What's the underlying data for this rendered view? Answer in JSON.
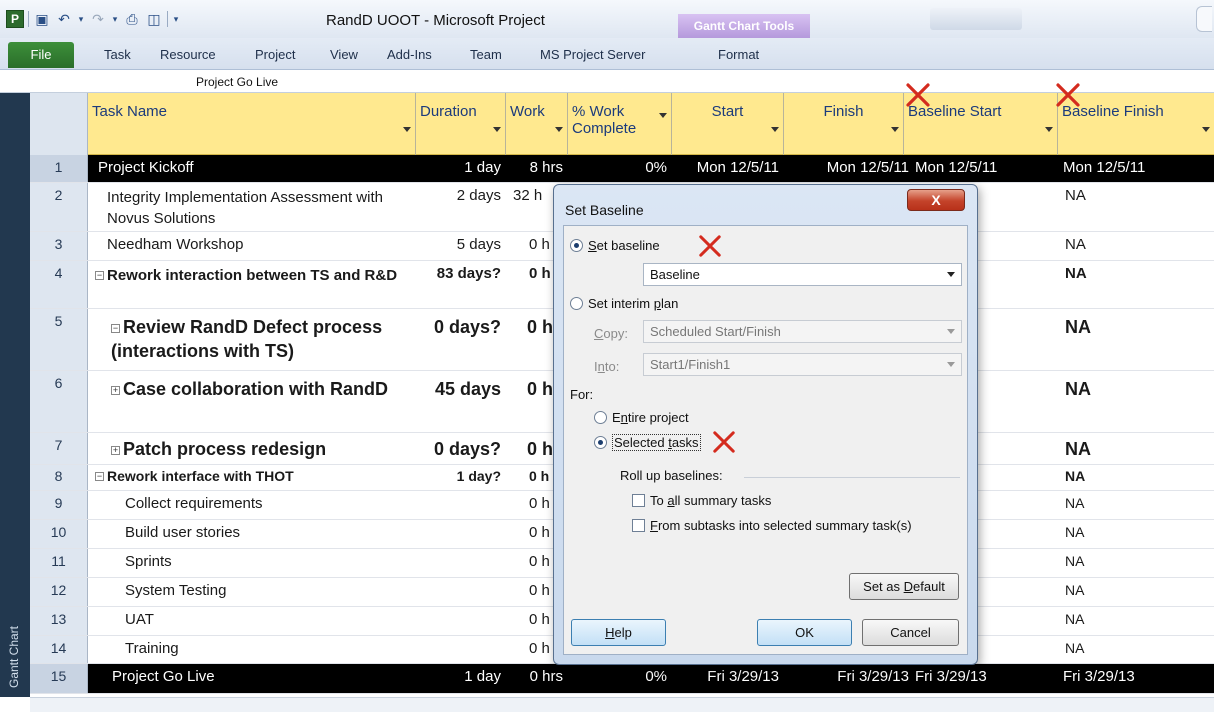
{
  "window": {
    "app_logo": "P",
    "title": "RandD UOOT - Microsoft Project",
    "tools_group": "Gantt Chart Tools"
  },
  "ribbon": {
    "file_tab": "File",
    "tabs": [
      "Task",
      "Resource",
      "Project",
      "View",
      "Add-Ins",
      "Team",
      "MS Project Server",
      "Format"
    ]
  },
  "entry_bar": {
    "value": "Project Go Live"
  },
  "sidebar": {
    "label": "Gantt Chart"
  },
  "columns": {
    "task_name": "Task Name",
    "duration": "Duration",
    "work": "Work",
    "pct_work_line1": "% Work",
    "pct_work_line2": "Complete",
    "start": "Start",
    "finish": "Finish",
    "baseline_start": "Baseline Start",
    "baseline_finish": "Baseline Finish"
  },
  "rows": [
    {
      "id": "1",
      "name": "Project Kickoff",
      "duration": "1 day",
      "work": "8 hrs",
      "pct": "0%",
      "start": "Mon 12/5/11",
      "finish": "Mon 12/5/11",
      "bstart": "Mon 12/5/11",
      "bfinish": "Mon 12/5/11"
    },
    {
      "id": "2",
      "name": "Integrity Implementation Assessment with Novus Solutions",
      "duration": "2 days",
      "work": "32 h",
      "bfinish": "NA"
    },
    {
      "id": "3",
      "name": "Needham Workshop",
      "duration": "5 days",
      "work": "0 h",
      "bfinish": "NA"
    },
    {
      "id": "4",
      "name": "Rework interaction between TS and R&D",
      "duration": "83 days?",
      "work": "0 h",
      "bfinish": "NA"
    },
    {
      "id": "5",
      "name": "Review RandD Defect process (interactions with TS)",
      "duration": "0 days?",
      "work": "0 h",
      "bfinish": "NA"
    },
    {
      "id": "6",
      "name": "Case collaboration with RandD",
      "duration": "45 days",
      "work": "0 h",
      "bfinish": "NA"
    },
    {
      "id": "7",
      "name": "Patch process redesign",
      "duration": "0 days?",
      "work": "0 h",
      "bfinish": "NA"
    },
    {
      "id": "8",
      "name": "Rework interface with THOT",
      "duration": "1 day?",
      "work": "0 h",
      "bfinish": "NA"
    },
    {
      "id": "9",
      "name": "Collect requirements",
      "work": "0 h",
      "bfinish": "NA"
    },
    {
      "id": "10",
      "name": "Build user stories",
      "work": "0 h",
      "bfinish": "NA"
    },
    {
      "id": "11",
      "name": "Sprints",
      "work": "0 h",
      "bfinish": "NA"
    },
    {
      "id": "12",
      "name": "System Testing",
      "work": "0 h",
      "bfinish": "NA"
    },
    {
      "id": "13",
      "name": "UAT",
      "work": "0 h",
      "bfinish": "NA"
    },
    {
      "id": "14",
      "name": "Training",
      "work": "0 h",
      "bfinish": "NA"
    },
    {
      "id": "15",
      "name": "Project Go Live",
      "duration": "1 day",
      "work": "0 hrs",
      "pct": "0%",
      "start": "Fri 3/29/13",
      "finish": "Fri 3/29/13",
      "bstart": "Fri 3/29/13",
      "bfinish": "Fri 3/29/13"
    }
  ],
  "expanders": {
    "minus": "−",
    "plus": "+"
  },
  "dialog": {
    "title": "Set Baseline",
    "close": "X",
    "set_baseline_pre": "",
    "set_baseline_u": "S",
    "set_baseline_post": "et baseline",
    "baseline_select": "Baseline",
    "interim_pre": "Set interim ",
    "interim_u": "p",
    "interim_post": "lan",
    "copy_u": "C",
    "copy_post": "opy:",
    "copy_value": "Scheduled Start/Finish",
    "into_pre": "I",
    "into_u": "n",
    "into_post": "to:",
    "into_value": "Start1/Finish1",
    "for_label": "For:",
    "entire_pre": "E",
    "entire_u": "n",
    "entire_post": "tire project",
    "selected_pre": "Selected ",
    "selected_u": "t",
    "selected_post": "asks",
    "rollup_label": "Roll up baselines:",
    "rollup_all_pre": "To ",
    "rollup_all_u": "a",
    "rollup_all_post": "ll summary tasks",
    "rollup_from_u": "F",
    "rollup_from_post": "rom subtasks into selected summary task(s)",
    "set_default_pre": "Set as ",
    "set_default_u": "D",
    "set_default_post": "efault",
    "help_u": "H",
    "help_post": "elp",
    "ok": "OK",
    "cancel": "Cancel"
  },
  "colors": {
    "header_bg": "#ffe98f",
    "summary_row": "#000000",
    "mark": "#d42b1e",
    "sidebar": "#22384f"
  }
}
